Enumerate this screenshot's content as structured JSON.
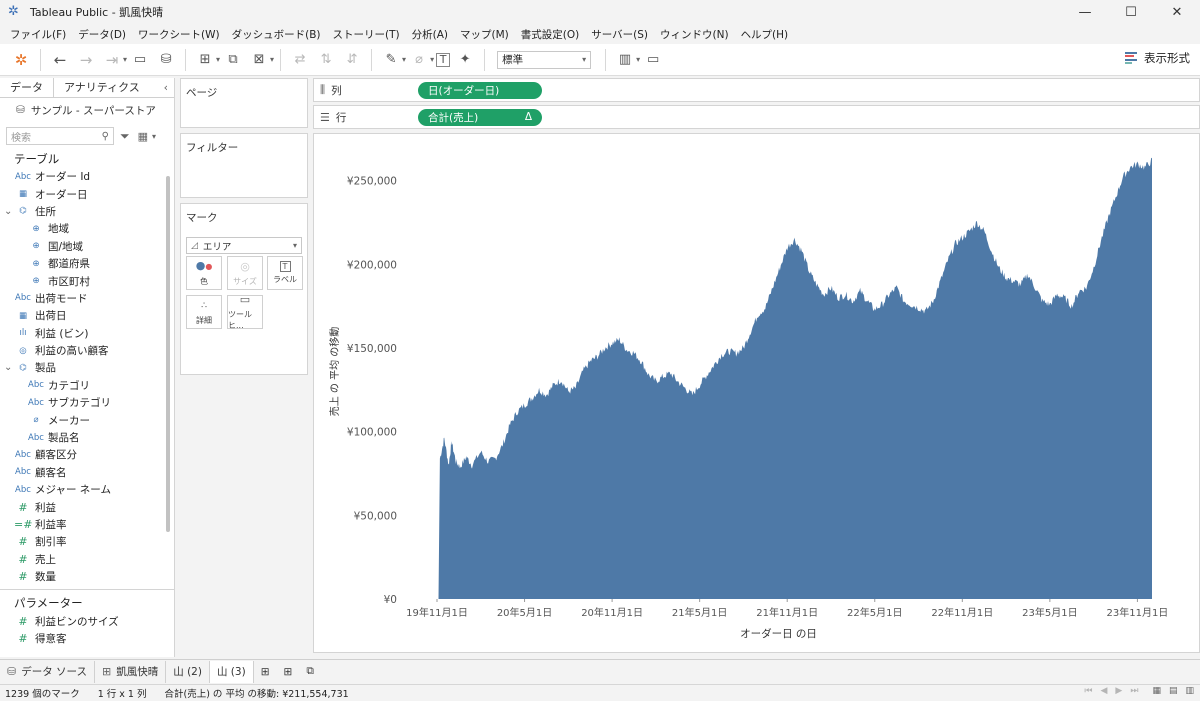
{
  "window": {
    "title": "Tableau Public - 凱風快晴",
    "minimize": "—",
    "maximize": "☐",
    "close": "✕"
  },
  "menu": [
    "ファイル(F)",
    "データ(D)",
    "ワークシート(W)",
    "ダッシュボード(B)",
    "ストーリー(T)",
    "分析(A)",
    "マップ(M)",
    "書式設定(O)",
    "サーバー(S)",
    "ウィンドウ(N)",
    "ヘルプ(H)"
  ],
  "toolbar": {
    "fit_value": "標準",
    "show_me_label": "表示形式"
  },
  "left_pane": {
    "tab_data": "データ",
    "tab_analytics": "アナリティクス",
    "datasource": "サンプル - スーパーストア",
    "search_placeholder": "検索",
    "tables_title": "テーブル",
    "fields": [
      {
        "icon": "Abc",
        "label": "オーダー Id",
        "indent": 0
      },
      {
        "icon": "cal",
        "label": "オーダー日",
        "indent": 0
      },
      {
        "icon": "hier",
        "label": "住所",
        "indent": -1
      },
      {
        "icon": "geo",
        "label": "地域",
        "indent": 1
      },
      {
        "icon": "geo",
        "label": "国/地域",
        "indent": 1
      },
      {
        "icon": "geo",
        "label": "都道府県",
        "indent": 1
      },
      {
        "icon": "geo",
        "label": "市区町村",
        "indent": 1
      },
      {
        "icon": "Abc",
        "label": "出荷モード",
        "indent": 0
      },
      {
        "icon": "cal",
        "label": "出荷日",
        "indent": 0
      },
      {
        "icon": "bin",
        "label": "利益 (ビン)",
        "indent": 0
      },
      {
        "icon": "set",
        "label": "利益の高い顧客",
        "indent": 0
      },
      {
        "icon": "hier",
        "label": "製品",
        "indent": -1
      },
      {
        "icon": "Abc",
        "label": "カテゴリ",
        "indent": 1
      },
      {
        "icon": "Abc",
        "label": "サブカテゴリ",
        "indent": 1
      },
      {
        "icon": "clip",
        "label": "メーカー",
        "indent": 1
      },
      {
        "icon": "Abc",
        "label": "製品名",
        "indent": 1
      },
      {
        "icon": "Abc",
        "label": "顧客区分",
        "indent": 0
      },
      {
        "icon": "Abc",
        "label": "顧客名",
        "indent": 0
      },
      {
        "icon": "Abc",
        "label": "メジャー ネーム",
        "indent": 0
      },
      {
        "icon": "#",
        "label": "利益",
        "indent": 0
      },
      {
        "icon": "=#",
        "label": "利益率",
        "indent": 0
      },
      {
        "icon": "#",
        "label": "割引率",
        "indent": 0
      },
      {
        "icon": "#",
        "label": "売上",
        "indent": 0
      },
      {
        "icon": "#",
        "label": "数量",
        "indent": 0
      }
    ],
    "params_title": "パラメーター",
    "params": [
      {
        "icon": "#",
        "label": "利益ビンのサイズ"
      },
      {
        "icon": "#",
        "label": "得意客"
      }
    ]
  },
  "cards": {
    "pages": "ページ",
    "filters": "フィルター",
    "marks": "マーク",
    "mark_type": "エリア",
    "mark_buttons": [
      "色",
      "サイズ",
      "ラベル",
      "詳細",
      "ツールヒ..."
    ]
  },
  "shelves": {
    "columns_label": "列",
    "rows_label": "行",
    "columns_pill": "日(オーダー日)",
    "rows_pill": "合計(売上)",
    "rows_pill_delta": "Δ"
  },
  "chart_data": {
    "type": "area",
    "xlabel": "オーダー日 の日",
    "ylabel": "売上 の 平均 の移動",
    "ylim": [
      0,
      260000
    ],
    "y_ticks": [
      "¥250,000",
      "¥200,000",
      "¥150,000",
      "¥100,000",
      "¥50,000",
      "¥0"
    ],
    "y_tick_values": [
      250000,
      200000,
      150000,
      100000,
      50000,
      0
    ],
    "x_ticks": [
      "19年11月1日",
      "20年5月1日",
      "20年11月1日",
      "21年5月1日",
      "21年11月1日",
      "22年5月1日",
      "22年11月1日",
      "23年5月1日",
      "23年11月1日"
    ],
    "x_tick_months": [
      0,
      6,
      12,
      18,
      24,
      30,
      36,
      42,
      48
    ],
    "x_start_months": 0.1,
    "x_end_months": 49,
    "fill_color": "#4e79a7",
    "series": [
      {
        "points": [
          [
            0.1,
            0
          ],
          [
            0.2,
            84000
          ],
          [
            0.5,
            96000
          ],
          [
            0.8,
            80000
          ],
          [
            1.0,
            94000
          ],
          [
            1.3,
            82000
          ],
          [
            1.6,
            79000
          ],
          [
            2.0,
            85000
          ],
          [
            2.4,
            80000
          ],
          [
            3.0,
            88000
          ],
          [
            3.5,
            82000
          ],
          [
            4.0,
            84000
          ],
          [
            4.5,
            92000
          ],
          [
            5.0,
            104000
          ],
          [
            5.5,
            112000
          ],
          [
            6.0,
            116000
          ],
          [
            6.5,
            120000
          ],
          [
            7.0,
            125000
          ],
          [
            7.5,
            122000
          ],
          [
            8.0,
            128000
          ],
          [
            8.5,
            131000
          ],
          [
            9.0,
            124000
          ],
          [
            9.5,
            126000
          ],
          [
            10.0,
            136000
          ],
          [
            10.5,
            142000
          ],
          [
            11.0,
            145000
          ],
          [
            11.5,
            150000
          ],
          [
            12.0,
            153000
          ],
          [
            12.5,
            155000
          ],
          [
            13.0,
            149000
          ],
          [
            13.5,
            147000
          ],
          [
            14.0,
            142000
          ],
          [
            14.5,
            134000
          ],
          [
            15.0,
            130000
          ],
          [
            15.5,
            133000
          ],
          [
            16.0,
            135000
          ],
          [
            16.5,
            130000
          ],
          [
            17.0,
            126000
          ],
          [
            17.5,
            122000
          ],
          [
            18.0,
            128000
          ],
          [
            18.5,
            134000
          ],
          [
            19.0,
            140000
          ],
          [
            19.5,
            146000
          ],
          [
            20.0,
            148000
          ],
          [
            20.5,
            147000
          ],
          [
            21.0,
            150000
          ],
          [
            21.5,
            160000
          ],
          [
            22.0,
            170000
          ],
          [
            22.5,
            174000
          ],
          [
            23.0,
            186000
          ],
          [
            23.5,
            198000
          ],
          [
            24.0,
            210000
          ],
          [
            24.5,
            215000
          ],
          [
            25.0,
            208000
          ],
          [
            25.5,
            196000
          ],
          [
            26.0,
            188000
          ],
          [
            26.5,
            182000
          ],
          [
            27.0,
            186000
          ],
          [
            27.5,
            180000
          ],
          [
            28.0,
            182000
          ],
          [
            28.5,
            178000
          ],
          [
            29.0,
            184000
          ],
          [
            29.5,
            178000
          ],
          [
            30.0,
            173000
          ],
          [
            30.5,
            176000
          ],
          [
            31.0,
            182000
          ],
          [
            31.5,
            186000
          ],
          [
            32.0,
            178000
          ],
          [
            32.5,
            176000
          ],
          [
            33.0,
            174000
          ],
          [
            33.5,
            172000
          ],
          [
            34.0,
            178000
          ],
          [
            34.5,
            190000
          ],
          [
            35.0,
            202000
          ],
          [
            35.5,
            212000
          ],
          [
            36.0,
            216000
          ],
          [
            36.5,
            220000
          ],
          [
            37.0,
            225000
          ],
          [
            37.5,
            220000
          ],
          [
            38.0,
            208000
          ],
          [
            38.5,
            198000
          ],
          [
            39.0,
            192000
          ],
          [
            39.5,
            190000
          ],
          [
            40.0,
            188000
          ],
          [
            40.5,
            194000
          ],
          [
            41.0,
            186000
          ],
          [
            41.5,
            178000
          ],
          [
            42.0,
            176000
          ],
          [
            42.5,
            182000
          ],
          [
            43.0,
            180000
          ],
          [
            43.5,
            175000
          ],
          [
            44.0,
            184000
          ],
          [
            44.5,
            186000
          ],
          [
            45.0,
            198000
          ],
          [
            45.5,
            214000
          ],
          [
            46.0,
            228000
          ],
          [
            46.5,
            240000
          ],
          [
            47.0,
            252000
          ],
          [
            47.5,
            258000
          ],
          [
            48.0,
            260000
          ],
          [
            48.5,
            258000
          ],
          [
            49.0,
            262000
          ],
          [
            49.0,
            0
          ]
        ]
      }
    ]
  },
  "sheet_tabs": [
    "データ ソース",
    "凱風快晴",
    "山 (2)",
    "山 (3)"
  ],
  "status": {
    "marks": "1239 個のマーク",
    "rowscols": "1 行 x 1 列",
    "summary": "合計(売上) の 平均 の移動: ¥211,554,731"
  }
}
